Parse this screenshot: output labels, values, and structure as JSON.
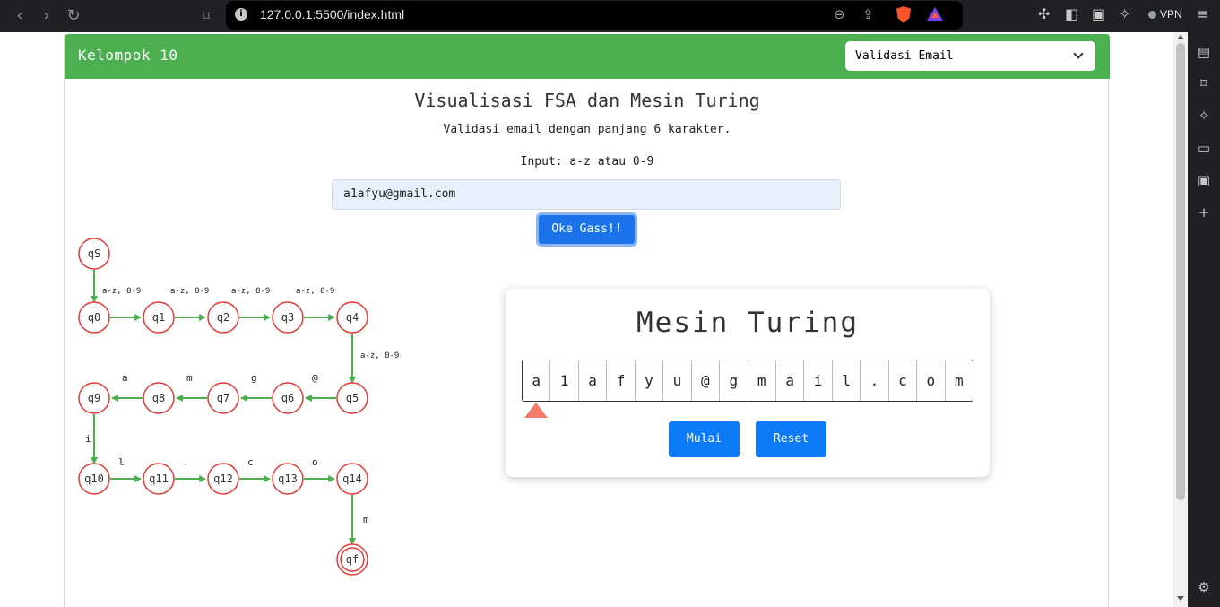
{
  "browser": {
    "url": "127.0.0.1:5500/index.html",
    "vpn_label": "VPN"
  },
  "header": {
    "brand": "Kelompok 10",
    "select_value": "Validasi Email"
  },
  "main": {
    "title": "Visualisasi FSA dan Mesin Turing",
    "subtitle": "Validasi email dengan panjang 6 karakter.",
    "input_label": "Input: a-z atau 0-9",
    "input_value": "a1afyu@gmail.com",
    "submit_label": "Oke Gass!!"
  },
  "fsa": {
    "states": [
      "qS",
      "q0",
      "q1",
      "q2",
      "q3",
      "q4",
      "q5",
      "q6",
      "q7",
      "q8",
      "q9",
      "q10",
      "q11",
      "q12",
      "q13",
      "q14",
      "qf"
    ],
    "accept_state": "qf",
    "transitions": [
      {
        "from": "qS",
        "to": "q0",
        "label": "a-z, 0-9"
      },
      {
        "from": "q0",
        "to": "q1",
        "label": "a-z, 0-9"
      },
      {
        "from": "q1",
        "to": "q2",
        "label": "a-z, 0-9"
      },
      {
        "from": "q2",
        "to": "q3",
        "label": "a-z, 0-9"
      },
      {
        "from": "q3",
        "to": "q4",
        "label": "a-z, 0-9"
      },
      {
        "from": "q4",
        "to": "q5",
        "label": "a-z, 0-9"
      },
      {
        "from": "q5",
        "to": "q6",
        "label": "@"
      },
      {
        "from": "q6",
        "to": "q7",
        "label": "g"
      },
      {
        "from": "q7",
        "to": "q8",
        "label": "m"
      },
      {
        "from": "q8",
        "to": "q9",
        "label": "a"
      },
      {
        "from": "q9",
        "to": "q10",
        "label": "i"
      },
      {
        "from": "q10",
        "to": "q11",
        "label": "l"
      },
      {
        "from": "q11",
        "to": "q12",
        "label": "."
      },
      {
        "from": "q12",
        "to": "q13",
        "label": "c"
      },
      {
        "from": "q13",
        "to": "q14",
        "label": "o"
      },
      {
        "from": "q14",
        "to": "qf",
        "label": "m"
      }
    ]
  },
  "turing": {
    "title": "Mesin Turing",
    "tape": [
      "a",
      "1",
      "a",
      "f",
      "y",
      "u",
      "@",
      "g",
      "m",
      "a",
      "i",
      "l",
      ".",
      "c",
      "o",
      "m"
    ],
    "head_index": 0,
    "start_label": "Mulai",
    "reset_label": "Reset"
  },
  "colors": {
    "header": "#4caf50",
    "state_stroke": "#e53935",
    "edge": "#4caf50",
    "button": "#0d7bf7",
    "head": "#f47b6b"
  }
}
